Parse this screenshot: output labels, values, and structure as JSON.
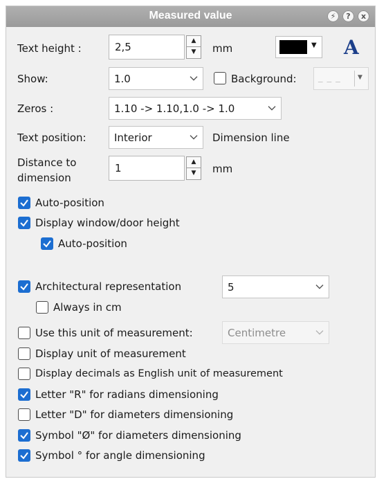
{
  "window": {
    "title": "Measured value",
    "buttons": [
      "⚡",
      "?",
      "x"
    ]
  },
  "text_height": {
    "label": "Text height :",
    "value": "2,5",
    "unit": "mm",
    "color": "#000000"
  },
  "text_style_icon": "A",
  "show": {
    "label": "Show:",
    "value": "1.0"
  },
  "background": {
    "label": "Background:",
    "checked": false,
    "value": "_ _ _"
  },
  "zeros": {
    "label": "Zeros :",
    "value": "1.10 -> 1.10,1.0 -> 1.0"
  },
  "text_position": {
    "label": "Text position:",
    "value": "Interior",
    "suffix": "Dimension line"
  },
  "distance": {
    "label_line1": "Distance to",
    "label_line2": "dimension",
    "value": "1",
    "unit": "mm"
  },
  "checks": {
    "auto_position": {
      "label": "Auto-position",
      "checked": true
    },
    "display_window_door_height": {
      "label": "Display window/door height",
      "checked": true
    },
    "auto_position_2": {
      "label": "Auto-position",
      "checked": true
    },
    "architectural_representation": {
      "label": "Architectural representation",
      "checked": true,
      "value": "5"
    },
    "always_in_cm": {
      "label": "Always in cm",
      "checked": false
    },
    "use_this_unit": {
      "label": "Use this unit of measurement:",
      "checked": false,
      "value": "Centimetre"
    },
    "display_unit": {
      "label": "Display unit of measurement",
      "checked": false
    },
    "display_decimals_english": {
      "label": "Display decimals as English unit of measurement",
      "checked": false
    },
    "letter_r": {
      "label": "Letter \"R\" for radians dimensioning",
      "checked": true
    },
    "letter_d": {
      "label": "Letter \"D\" for diameters dimensioning",
      "checked": false
    },
    "symbol_o": {
      "label": "Symbol \"Ø\" for diameters dimensioning",
      "checked": true
    },
    "symbol_deg": {
      "label": "Symbol ° for angle dimensioning",
      "checked": true
    }
  },
  "colors": {
    "accent": "#1c6ed1",
    "title_bar": "#a3a3a3",
    "panel": "#f0f0f0"
  }
}
